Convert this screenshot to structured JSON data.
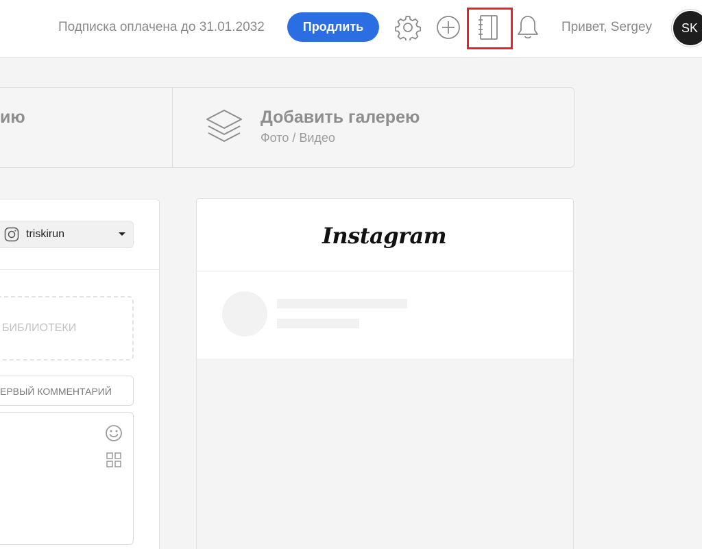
{
  "header": {
    "subscription_text": "Подписка оплачена до 31.01.2032",
    "renew_label": "Продлить",
    "greeting": "Привет, Sergey",
    "avatar_initials": "SK",
    "icons": [
      "gear-icon",
      "plus-circle-icon",
      "notebook-icon",
      "bell-icon"
    ],
    "accent_color": "#2b6ee3",
    "highlight_color": "#e32626"
  },
  "add_panel": {
    "left_label_partial": "ию",
    "gallery_title": "Добавить галерею",
    "gallery_subtitle": "Фото / Видео"
  },
  "editor": {
    "account_name": "triskirun",
    "library_label_partial": "БИБЛИОТЕКИ",
    "first_comment_label_partial": "ЕРВЫЙ КОММЕНТАРИЙ"
  },
  "preview": {
    "logo_text": "Instagram"
  }
}
